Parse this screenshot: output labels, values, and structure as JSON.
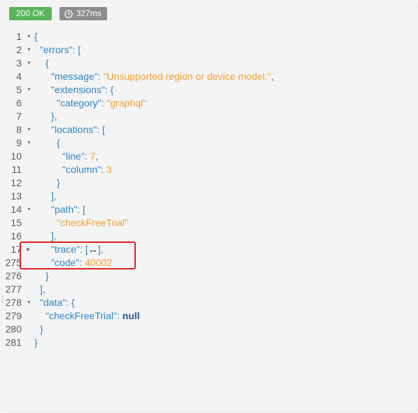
{
  "status": {
    "code_label": "200 OK",
    "time_label": "327ms"
  },
  "lines": [
    {
      "n": "1",
      "fold": "▼",
      "indent": 0,
      "parts": [
        {
          "t": "{",
          "c": "p"
        }
      ]
    },
    {
      "n": "2",
      "fold": "▼",
      "indent": 1,
      "parts": [
        {
          "t": "\"errors\"",
          "c": "key"
        },
        {
          "t": ": [",
          "c": "p"
        }
      ]
    },
    {
      "n": "3",
      "fold": "▼",
      "indent": 2,
      "parts": [
        {
          "t": "{",
          "c": "p"
        }
      ]
    },
    {
      "n": "4",
      "fold": "",
      "indent": 3,
      "parts": [
        {
          "t": "\"message\"",
          "c": "key"
        },
        {
          "t": ": ",
          "c": "p"
        },
        {
          "t": "\"Unsupported region or device model.\"",
          "c": "str"
        },
        {
          "t": ",",
          "c": "p"
        }
      ]
    },
    {
      "n": "5",
      "fold": "▼",
      "indent": 3,
      "parts": [
        {
          "t": "\"extensions\"",
          "c": "key"
        },
        {
          "t": ": {",
          "c": "p"
        }
      ]
    },
    {
      "n": "6",
      "fold": "",
      "indent": 4,
      "parts": [
        {
          "t": "\"category\"",
          "c": "key"
        },
        {
          "t": ": ",
          "c": "p"
        },
        {
          "t": "\"graphql\"",
          "c": "str"
        }
      ]
    },
    {
      "n": "7",
      "fold": "",
      "indent": 3,
      "parts": [
        {
          "t": "},",
          "c": "p"
        }
      ]
    },
    {
      "n": "8",
      "fold": "▼",
      "indent": 3,
      "parts": [
        {
          "t": "\"locations\"",
          "c": "key"
        },
        {
          "t": ": [",
          "c": "p"
        }
      ]
    },
    {
      "n": "9",
      "fold": "▼",
      "indent": 4,
      "parts": [
        {
          "t": "{",
          "c": "p"
        }
      ]
    },
    {
      "n": "10",
      "fold": "",
      "indent": 5,
      "parts": [
        {
          "t": "\"line\"",
          "c": "key"
        },
        {
          "t": ": ",
          "c": "p"
        },
        {
          "t": "7",
          "c": "num"
        },
        {
          "t": ",",
          "c": "p"
        }
      ]
    },
    {
      "n": "11",
      "fold": "",
      "indent": 5,
      "parts": [
        {
          "t": "\"column\"",
          "c": "key"
        },
        {
          "t": ": ",
          "c": "p"
        },
        {
          "t": "3",
          "c": "num"
        }
      ]
    },
    {
      "n": "12",
      "fold": "",
      "indent": 4,
      "parts": [
        {
          "t": "}",
          "c": "p"
        }
      ]
    },
    {
      "n": "13",
      "fold": "",
      "indent": 3,
      "parts": [
        {
          "t": "],",
          "c": "p"
        }
      ]
    },
    {
      "n": "14",
      "fold": "▼",
      "indent": 3,
      "parts": [
        {
          "t": "\"path\"",
          "c": "key"
        },
        {
          "t": ": [",
          "c": "p"
        }
      ]
    },
    {
      "n": "15",
      "fold": "",
      "indent": 4,
      "parts": [
        {
          "t": "\"checkFreeTrial\"",
          "c": "str"
        }
      ]
    },
    {
      "n": "16",
      "fold": "",
      "indent": 3,
      "parts": [
        {
          "t": "],",
          "c": "p"
        }
      ]
    },
    {
      "n": "17",
      "fold": "▶",
      "indent": 3,
      "parts": [
        {
          "t": "\"trace\"",
          "c": "key"
        },
        {
          "t": ": [",
          "c": "p"
        },
        {
          "t": "↔",
          "c": "collapsed"
        },
        {
          "t": "],",
          "c": "p"
        }
      ]
    },
    {
      "n": "275",
      "fold": "",
      "indent": 3,
      "parts": [
        {
          "t": "\"code\"",
          "c": "key"
        },
        {
          "t": ": ",
          "c": "p"
        },
        {
          "t": "40002",
          "c": "num"
        }
      ]
    },
    {
      "n": "276",
      "fold": "",
      "indent": 2,
      "parts": [
        {
          "t": "}",
          "c": "p"
        }
      ]
    },
    {
      "n": "277",
      "fold": "",
      "indent": 1,
      "parts": [
        {
          "t": "],",
          "c": "p"
        }
      ]
    },
    {
      "n": "278",
      "fold": "▼",
      "indent": 1,
      "parts": [
        {
          "t": "\"data\"",
          "c": "key"
        },
        {
          "t": ": {",
          "c": "p"
        }
      ]
    },
    {
      "n": "279",
      "fold": "",
      "indent": 2,
      "parts": [
        {
          "t": "\"checkFreeTrial\"",
          "c": "key"
        },
        {
          "t": ": ",
          "c": "p"
        },
        {
          "t": "null",
          "c": "kw"
        }
      ]
    },
    {
      "n": "280",
      "fold": "",
      "indent": 1,
      "parts": [
        {
          "t": "}",
          "c": "p"
        }
      ]
    },
    {
      "n": "281",
      "fold": "",
      "indent": 0,
      "parts": [
        {
          "t": "}",
          "c": "p"
        }
      ]
    }
  ]
}
